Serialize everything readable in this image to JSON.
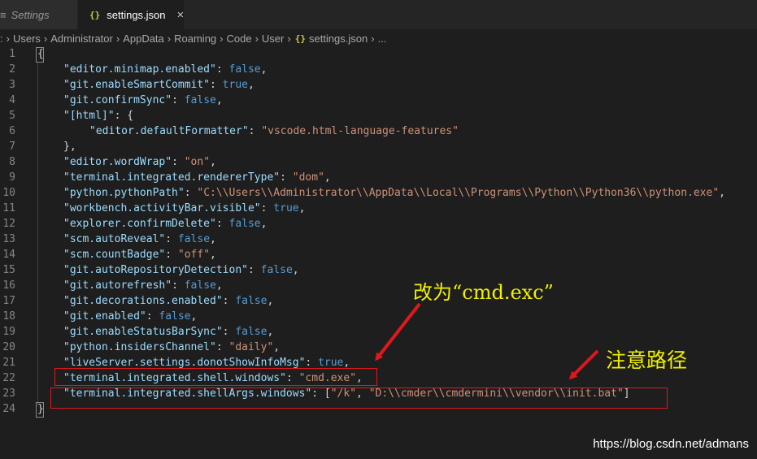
{
  "tabs": [
    {
      "label": "Settings",
      "lead": "≡"
    },
    {
      "label": "settings.json",
      "icon": "{}",
      "close": "×"
    }
  ],
  "breadcrumb": {
    "lead": ":",
    "segments": [
      "Users",
      "Administrator",
      "AppData",
      "Roaming",
      "Code",
      "User"
    ],
    "file_icon": "{}",
    "file": "settings.json",
    "more": "..."
  },
  "editor": {
    "lines": [
      {
        "n": "1",
        "tokens": [
          {
            "t": "p",
            "v": "{"
          }
        ]
      },
      {
        "n": "2",
        "tokens": [
          {
            "t": "key",
            "v": "\"editor.minimap.enabled\""
          },
          {
            "t": "p",
            "v": ": "
          },
          {
            "t": "kw",
            "v": "false"
          },
          {
            "t": "p",
            "v": ","
          }
        ]
      },
      {
        "n": "3",
        "tokens": [
          {
            "t": "key",
            "v": "\"git.enableSmartCommit\""
          },
          {
            "t": "p",
            "v": ": "
          },
          {
            "t": "kw",
            "v": "true"
          },
          {
            "t": "p",
            "v": ","
          }
        ]
      },
      {
        "n": "4",
        "tokens": [
          {
            "t": "key",
            "v": "\"git.confirmSync\""
          },
          {
            "t": "p",
            "v": ": "
          },
          {
            "t": "kw",
            "v": "false"
          },
          {
            "t": "p",
            "v": ","
          }
        ]
      },
      {
        "n": "5",
        "tokens": [
          {
            "t": "key",
            "v": "\"[html]\""
          },
          {
            "t": "p",
            "v": ": {"
          }
        ]
      },
      {
        "n": "6",
        "indent": 2,
        "tokens": [
          {
            "t": "key",
            "v": "\"editor.defaultFormatter\""
          },
          {
            "t": "p",
            "v": ": "
          },
          {
            "t": "str",
            "v": "\"vscode.html-language-features\""
          }
        ]
      },
      {
        "n": "7",
        "tokens": [
          {
            "t": "p",
            "v": "},"
          }
        ]
      },
      {
        "n": "8",
        "tokens": [
          {
            "t": "key",
            "v": "\"editor.wordWrap\""
          },
          {
            "t": "p",
            "v": ": "
          },
          {
            "t": "str",
            "v": "\"on\""
          },
          {
            "t": "p",
            "v": ","
          }
        ]
      },
      {
        "n": "9",
        "tokens": [
          {
            "t": "key",
            "v": "\"terminal.integrated.rendererType\""
          },
          {
            "t": "p",
            "v": ": "
          },
          {
            "t": "str",
            "v": "\"dom\""
          },
          {
            "t": "p",
            "v": ","
          }
        ]
      },
      {
        "n": "10",
        "tokens": [
          {
            "t": "key",
            "v": "\"python.pythonPath\""
          },
          {
            "t": "p",
            "v": ": "
          },
          {
            "t": "str",
            "v": "\"C:\\\\Users\\\\Administrator\\\\AppData\\\\Local\\\\Programs\\\\Python\\\\Python36\\\\python.exe\""
          },
          {
            "t": "p",
            "v": ","
          }
        ]
      },
      {
        "n": "11",
        "tokens": [
          {
            "t": "key",
            "v": "\"workbench.activityBar.visible\""
          },
          {
            "t": "p",
            "v": ": "
          },
          {
            "t": "kw",
            "v": "true"
          },
          {
            "t": "p",
            "v": ","
          }
        ]
      },
      {
        "n": "12",
        "tokens": [
          {
            "t": "key",
            "v": "\"explorer.confirmDelete\""
          },
          {
            "t": "p",
            "v": ": "
          },
          {
            "t": "kw",
            "v": "false"
          },
          {
            "t": "p",
            "v": ","
          }
        ]
      },
      {
        "n": "13",
        "tokens": [
          {
            "t": "key",
            "v": "\"scm.autoReveal\""
          },
          {
            "t": "p",
            "v": ": "
          },
          {
            "t": "kw",
            "v": "false"
          },
          {
            "t": "p",
            "v": ","
          }
        ]
      },
      {
        "n": "14",
        "tokens": [
          {
            "t": "key",
            "v": "\"scm.countBadge\""
          },
          {
            "t": "p",
            "v": ": "
          },
          {
            "t": "str",
            "v": "\"off\""
          },
          {
            "t": "p",
            "v": ","
          }
        ]
      },
      {
        "n": "15",
        "tokens": [
          {
            "t": "key",
            "v": "\"git.autoRepositoryDetection\""
          },
          {
            "t": "p",
            "v": ": "
          },
          {
            "t": "kw",
            "v": "false"
          },
          {
            "t": "p",
            "v": ","
          }
        ]
      },
      {
        "n": "16",
        "tokens": [
          {
            "t": "key",
            "v": "\"git.autorefresh\""
          },
          {
            "t": "p",
            "v": ": "
          },
          {
            "t": "kw",
            "v": "false"
          },
          {
            "t": "p",
            "v": ","
          }
        ]
      },
      {
        "n": "17",
        "tokens": [
          {
            "t": "key",
            "v": "\"git.decorations.enabled\""
          },
          {
            "t": "p",
            "v": ": "
          },
          {
            "t": "kw",
            "v": "false"
          },
          {
            "t": "p",
            "v": ","
          }
        ]
      },
      {
        "n": "18",
        "tokens": [
          {
            "t": "key",
            "v": "\"git.enabled\""
          },
          {
            "t": "p",
            "v": ": "
          },
          {
            "t": "kw",
            "v": "false"
          },
          {
            "t": "p",
            "v": ","
          }
        ]
      },
      {
        "n": "19",
        "tokens": [
          {
            "t": "key",
            "v": "\"git.enableStatusBarSync\""
          },
          {
            "t": "p",
            "v": ": "
          },
          {
            "t": "kw",
            "v": "false"
          },
          {
            "t": "p",
            "v": ","
          }
        ]
      },
      {
        "n": "20",
        "tokens": [
          {
            "t": "key",
            "v": "\"python.insidersChannel\""
          },
          {
            "t": "p",
            "v": ": "
          },
          {
            "t": "str",
            "v": "\"daily\""
          },
          {
            "t": "p",
            "v": ","
          }
        ]
      },
      {
        "n": "21",
        "tokens": [
          {
            "t": "key",
            "v": "\"liveServer.settings.donotShowInfoMsg\""
          },
          {
            "t": "p",
            "v": ": "
          },
          {
            "t": "kw",
            "v": "true"
          },
          {
            "t": "p",
            "v": ","
          }
        ]
      },
      {
        "n": "22",
        "tokens": [
          {
            "t": "key",
            "v": "\"terminal.integrated.shell.windows\""
          },
          {
            "t": "p",
            "v": ": "
          },
          {
            "t": "str",
            "v": "\"cmd.exe\""
          },
          {
            "t": "p",
            "v": ","
          }
        ]
      },
      {
        "n": "23",
        "tokens": [
          {
            "t": "key",
            "v": "\"terminal.integrated.shellArgs.windows\""
          },
          {
            "t": "p",
            "v": ": ["
          },
          {
            "t": "str",
            "v": "\"/k\""
          },
          {
            "t": "p",
            "v": ", "
          },
          {
            "t": "str",
            "v": "\"D:\\\\cmder\\\\cmdermini\\\\vendor\\\\init.bat\""
          },
          {
            "t": "p",
            "v": "]"
          }
        ]
      },
      {
        "n": "24",
        "tokens": [
          {
            "t": "p",
            "v": "}"
          }
        ]
      }
    ]
  },
  "annotations": {
    "change_to": "改为“cmd.exc”",
    "note_path": "注意路径"
  },
  "watermark": "https://blog.csdn.net/admans",
  "colors": {
    "annotation": "#f0f000",
    "highlight_box": "#e0181d",
    "arrow": "#e0181d",
    "key": "#9cdcfe",
    "string": "#ce9178",
    "keyword": "#569cd6"
  }
}
